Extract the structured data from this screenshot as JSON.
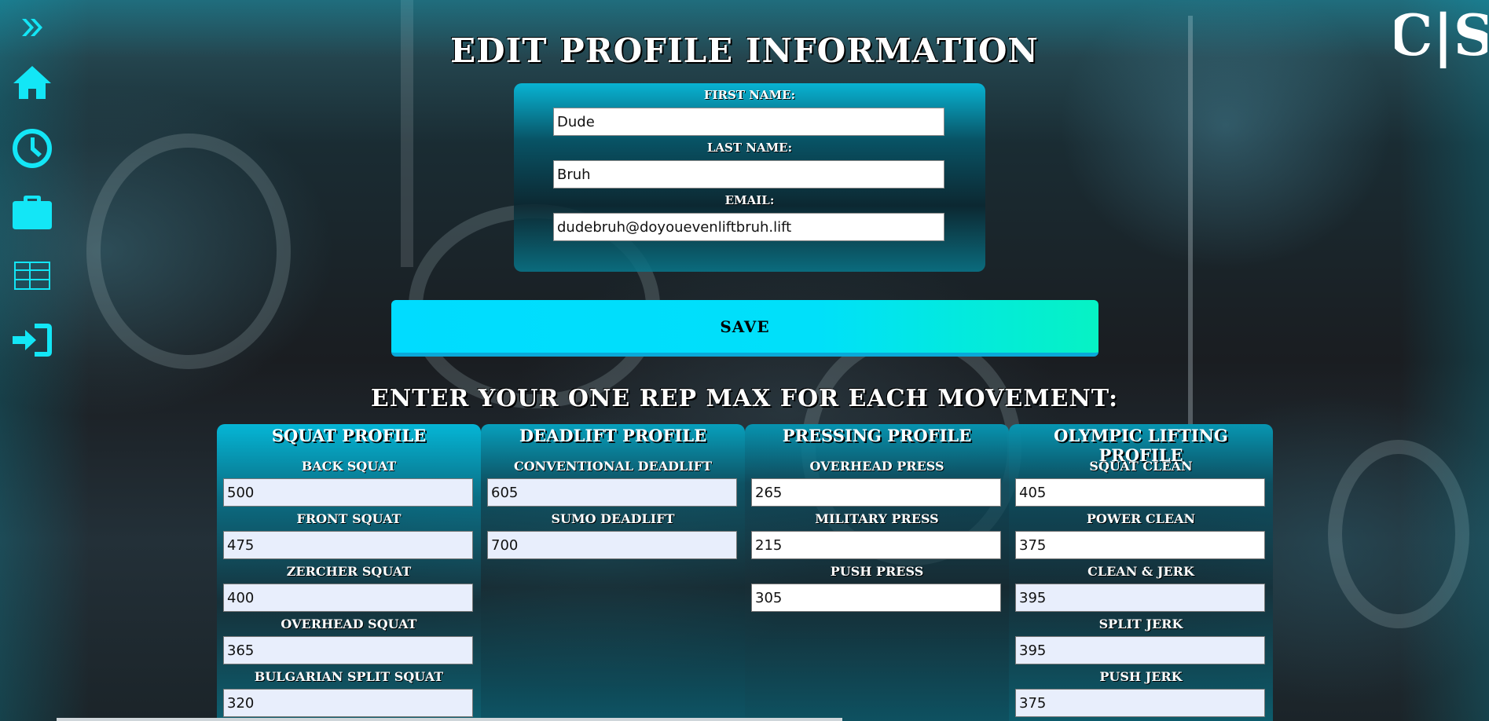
{
  "logo": {
    "text": "C|S"
  },
  "sidebar": {
    "items": [
      {
        "icon": "chevron-double-right-icon"
      },
      {
        "icon": "home-icon"
      },
      {
        "icon": "clock-icon"
      },
      {
        "icon": "briefcase-icon"
      },
      {
        "icon": "table-icon"
      },
      {
        "icon": "sign-in-icon"
      }
    ],
    "icon_color": "#13e6f6"
  },
  "profile": {
    "title": "EDIT PROFILE INFORMATION",
    "first_name_label": "FIRST NAME:",
    "first_name_value": "Dude",
    "last_name_label": "LAST NAME:",
    "last_name_value": "Bruh",
    "email_label": "EMAIL:",
    "email_value": "dudebruh@doyouevenliftbruh.lift"
  },
  "save_label": "SAVE",
  "rep_max": {
    "title": "ENTER YOUR ONE REP MAX FOR EACH MOVEMENT:",
    "columns": [
      {
        "title": "SQUAT PROFILE",
        "lifts": [
          {
            "label": "BACK SQUAT",
            "value": "500"
          },
          {
            "label": "FRONT SQUAT",
            "value": "475"
          },
          {
            "label": "ZERCHER SQUAT",
            "value": "400"
          },
          {
            "label": "OVERHEAD SQUAT",
            "value": "365"
          },
          {
            "label": "BULGARIAN SPLIT SQUAT",
            "value": "320"
          }
        ]
      },
      {
        "title": "DEADLIFT PROFILE",
        "lifts": [
          {
            "label": "CONVENTIONAL DEADLIFT",
            "value": "605"
          },
          {
            "label": "SUMO DEADLIFT",
            "value": "700"
          }
        ]
      },
      {
        "title": "PRESSING PROFILE",
        "lifts": [
          {
            "label": "OVERHEAD PRESS",
            "value": "265"
          },
          {
            "label": "MILITARY PRESS",
            "value": "215"
          },
          {
            "label": "PUSH PRESS",
            "value": "305"
          }
        ]
      },
      {
        "title": "OLYMPIC LIFTING PROFILE",
        "lifts": [
          {
            "label": "SQUAT CLEAN",
            "value": "405"
          },
          {
            "label": "POWER CLEAN",
            "value": "375"
          },
          {
            "label": "CLEAN & JERK",
            "value": "395"
          },
          {
            "label": "SPLIT JERK",
            "value": "395"
          },
          {
            "label": "PUSH JERK",
            "value": "375"
          }
        ]
      }
    ]
  }
}
